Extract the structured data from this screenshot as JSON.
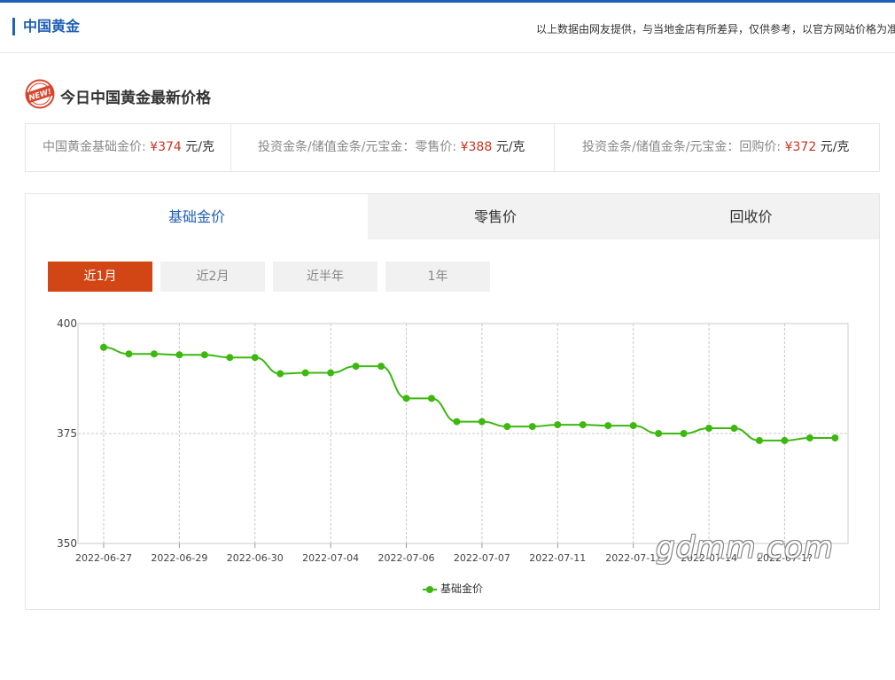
{
  "header": {
    "brand": "中国黄金",
    "notice": "以上数据由网友提供，与当地金店有所差异，仅供参考，以官方网站价格为准"
  },
  "section": {
    "badge": "NEW!",
    "title": "今日中国黄金最新价格"
  },
  "prices": [
    {
      "label": "中国黄金基础金价:",
      "value": "¥374",
      "unit": "元/克"
    },
    {
      "label": "投资金条/储值金条/元宝金：零售价:",
      "value": "¥388",
      "unit": "元/克"
    },
    {
      "label": "投资金条/储值金条/元宝金：回购价:",
      "value": "¥372",
      "unit": "元/克"
    }
  ],
  "tabs": [
    {
      "label": "基础金价",
      "active": true
    },
    {
      "label": "零售价",
      "active": false
    },
    {
      "label": "回收价",
      "active": false
    }
  ],
  "ranges": [
    {
      "label": "近1月",
      "active": true
    },
    {
      "label": "近2月",
      "active": false
    },
    {
      "label": "近半年",
      "active": false
    },
    {
      "label": "1年",
      "active": false
    }
  ],
  "colors": {
    "brand": "#1f5fb5",
    "accent": "#d24615",
    "price": "#c7351f",
    "line": "#3cb80f"
  },
  "watermark": "gdmm.com",
  "chart_data": {
    "type": "line",
    "title": "",
    "xlabel": "",
    "ylabel": "",
    "ylim": [
      350,
      400
    ],
    "yticks": [
      350,
      375,
      400
    ],
    "grid": true,
    "legend": "bottom-center",
    "x_tick_labels": [
      "2022-06-27",
      "2022-06-29",
      "2022-06-30",
      "2022-07-04",
      "2022-07-06",
      "2022-07-07",
      "2022-07-11",
      "2022-07-1?",
      "2022-07-14",
      "2022-07-1?"
    ],
    "series": [
      {
        "name": "基础金价",
        "values": [
          394.6,
          393.1,
          393.1,
          392.9,
          392.9,
          392.3,
          392.3,
          388.6,
          388.8,
          388.8,
          390.3,
          390.3,
          383.0,
          383.0,
          377.7,
          377.7,
          376.6,
          376.6,
          377.0,
          377.0,
          376.8,
          376.8,
          375.0,
          375.0,
          376.2,
          376.2,
          373.4,
          373.4,
          374.0,
          374.0
        ]
      }
    ]
  }
}
